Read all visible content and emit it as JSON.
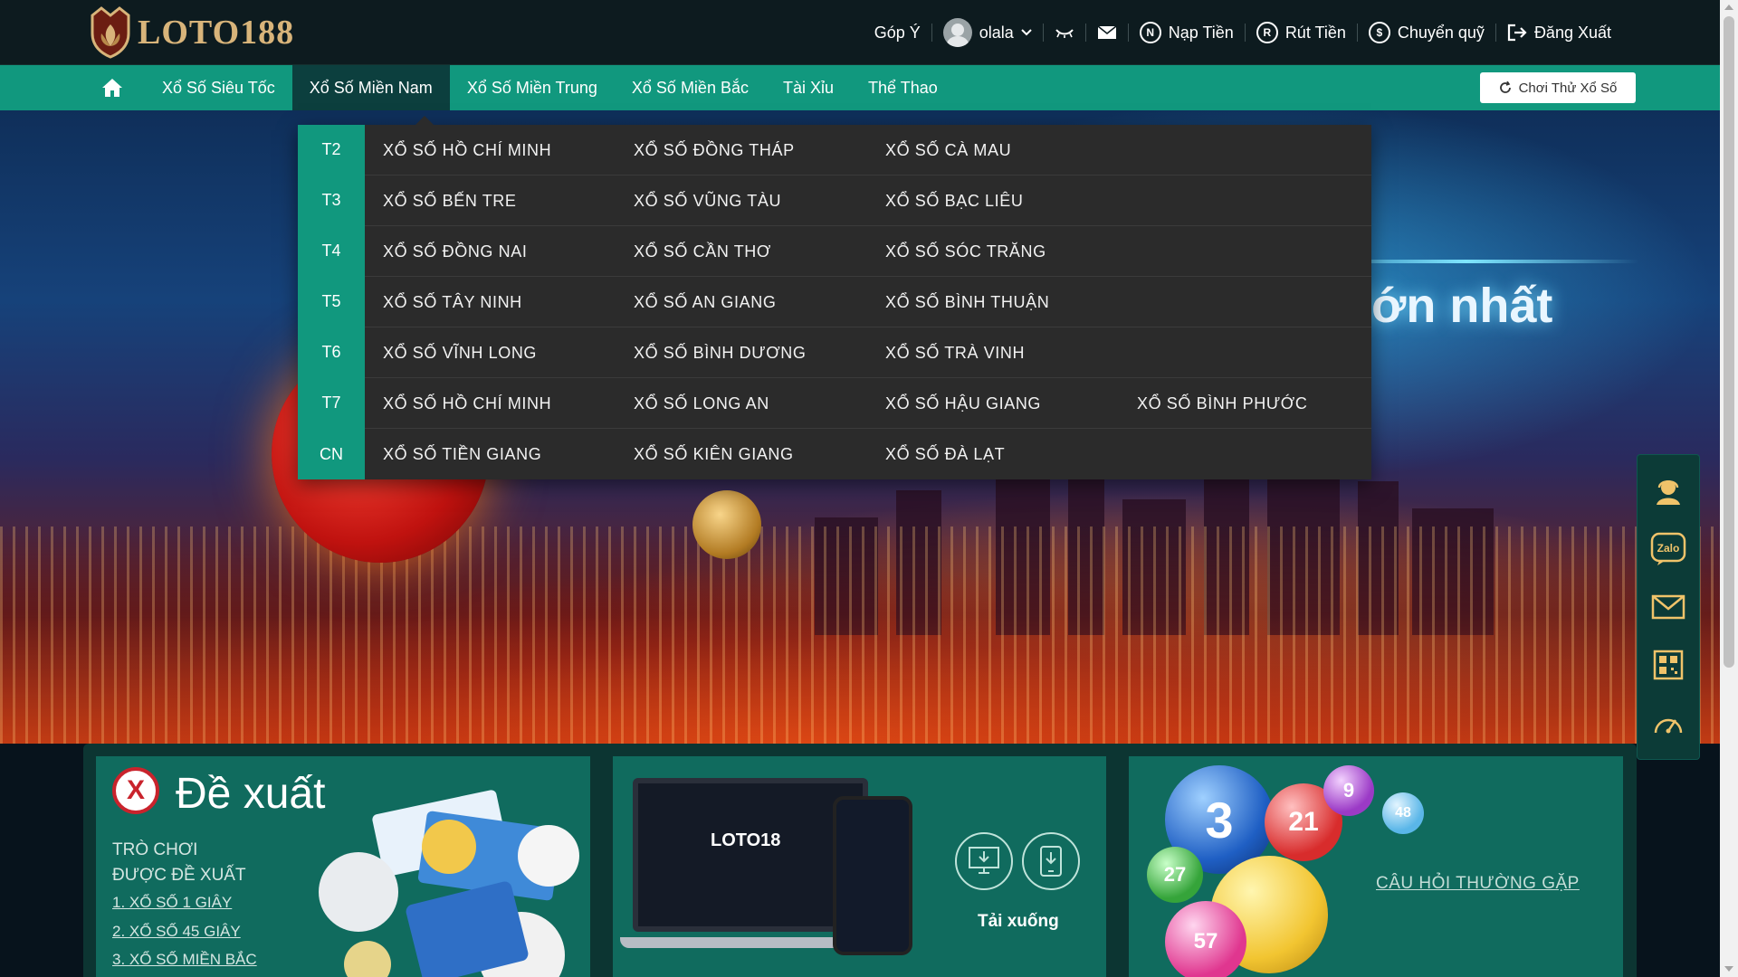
{
  "header": {
    "logo_text": "LOTO188",
    "feedback": "Góp Ý",
    "username": "olala",
    "deposit": "Nạp Tiền",
    "withdraw": "Rút Tiền",
    "transfer": "Chuyển quỹ",
    "logout": "Đăng Xuất",
    "deposit_letter": "N",
    "withdraw_letter": "R",
    "transfer_letter": "$"
  },
  "nav": {
    "items": [
      {
        "label": "Xổ Số Siêu Tốc"
      },
      {
        "label": "Xổ Số Miền Nam",
        "active": true
      },
      {
        "label": "Xổ Số Miền Trung"
      },
      {
        "label": "Xổ Số Miền Bắc"
      },
      {
        "label": "Tài Xỉu"
      },
      {
        "label": "Thể Thao"
      }
    ],
    "trial_button": "Chơi Thử Xổ Số"
  },
  "dropdown": {
    "rows": [
      {
        "day": "T2",
        "links": [
          "XỔ SỐ HỒ CHÍ MINH",
          "XỔ SỐ ĐỒNG THÁP",
          "XỔ SỐ CÀ MAU",
          ""
        ]
      },
      {
        "day": "T3",
        "links": [
          "XỔ SỐ BẾN TRE",
          "XỔ SỐ VŨNG TÀU",
          "XỔ SỐ BẠC LIÊU",
          ""
        ]
      },
      {
        "day": "T4",
        "links": [
          "XỔ SỐ ĐỒNG NAI",
          "XỔ SỐ CẦN THƠ",
          "XỔ SỐ SÓC TRĂNG",
          ""
        ]
      },
      {
        "day": "T5",
        "links": [
          "XỔ SỐ TÂY NINH",
          "XỔ SỐ AN GIANG",
          "XỔ SỐ BÌNH THUẬN",
          ""
        ]
      },
      {
        "day": "T6",
        "links": [
          "XỔ SỐ VĨNH LONG",
          "XỔ SỐ BÌNH DƯƠNG",
          "XỔ SỐ TRÀ VINH",
          ""
        ]
      },
      {
        "day": "T7",
        "links": [
          "XỔ SỐ HỒ CHÍ MINH",
          "XỔ SỐ LONG AN",
          "XỔ SỐ HẬU GIANG",
          "XỔ SỐ BÌNH PHƯỚC"
        ]
      },
      {
        "day": "CN",
        "links": [
          "XỔ SỐ TIỀN GIANG",
          "XỔ SỐ KIÊN GIANG",
          "XỔ SỐ ĐÀ LẠT",
          ""
        ]
      }
    ]
  },
  "hero": {
    "slogan": "lớn nhất"
  },
  "side_panel": {
    "icons": [
      "support-agent-icon",
      "zalo-icon",
      "mail-icon",
      "qr-code-icon",
      "speedometer-icon"
    ],
    "zalo_text": "Zalo"
  },
  "cards": {
    "recommend": {
      "logo_letter": "X",
      "title": "Đề xuất",
      "subtitle_line1": "TRÒ CHƠI",
      "subtitle_line2": "ĐƯỢC ĐỀ XUẤT",
      "links": [
        "1. XỔ SỐ 1 GIÂY",
        "2. XỔ SỐ 45 GIÂY",
        "3. XỔ SỐ MIỀN BẮC"
      ]
    },
    "download": {
      "screen_text": "LOTO18",
      "label": "Tải xuống"
    },
    "faq": {
      "link": "CÂU HỎI THƯỜNG GẶP",
      "balls": [
        "3",
        "21",
        "27",
        "9",
        "48",
        "57"
      ]
    }
  },
  "colors": {
    "nav_green": "#11987e",
    "topbar": "#0d1b1f",
    "dropdown_bg": "#2b2b2b",
    "card_teal": "#106b5e"
  }
}
